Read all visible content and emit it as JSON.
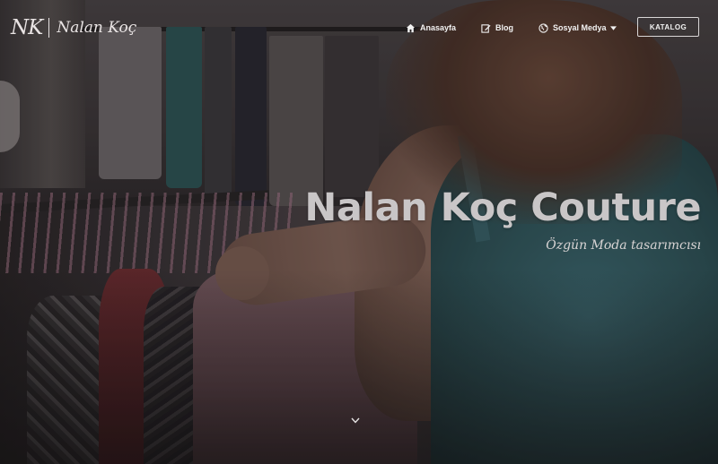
{
  "brand": {
    "monogram": "NK",
    "name": "Nalan Koç"
  },
  "nav": {
    "items": [
      {
        "label": "Anasayfa",
        "icon": "home-icon"
      },
      {
        "label": "Blog",
        "icon": "edit-icon"
      },
      {
        "label": "Sosyal Medya",
        "icon": "globe-icon",
        "dropdown": true
      }
    ],
    "catalog_button": "KATALOG"
  },
  "hero": {
    "title": "Nalan Koç Couture",
    "subtitle": "Özgün Moda tasarımcısı",
    "scroll_icon": "chevron-down-icon"
  },
  "colors": {
    "nav_text": "#f2f2f2",
    "title_text": "#c9c6c7",
    "subtitle_text": "#d8d4d4",
    "button_border": "#d9d6d6"
  }
}
